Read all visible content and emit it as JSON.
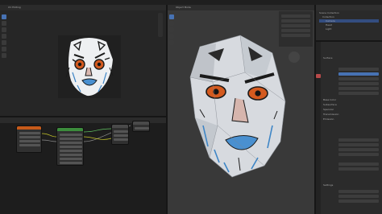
{
  "app": {
    "name": "Blender"
  },
  "topbar": {
    "menu_dots": [
      "•",
      "•",
      "•",
      "•",
      "•",
      "•"
    ]
  },
  "uv_editor": {
    "header_label": "UV Editing"
  },
  "node_editor": {
    "nodes": [
      {
        "title": "Image Texture",
        "color": "#c65a1a"
      },
      {
        "title": "Principled BSDF",
        "color": "#3c8c3c"
      },
      {
        "title": "Mix",
        "color": "#4a4a4a"
      },
      {
        "title": "Material Output",
        "color": "#4a4a4a"
      }
    ]
  },
  "viewport": {
    "header_label": "User Perspective",
    "mode": "Object Mode"
  },
  "outliner": {
    "title": "Scene Collection",
    "items": [
      "Collection",
      "Camera",
      "Head",
      "Light"
    ]
  },
  "properties": {
    "sections": [
      "Surface",
      "Base Color",
      "Subsurface",
      "Specular",
      "Transmission",
      "Emission",
      "Settings"
    ]
  },
  "colors": {
    "accent": "#4772b3",
    "panel": "#282828",
    "header": "#303030",
    "link": "#c7c729"
  }
}
